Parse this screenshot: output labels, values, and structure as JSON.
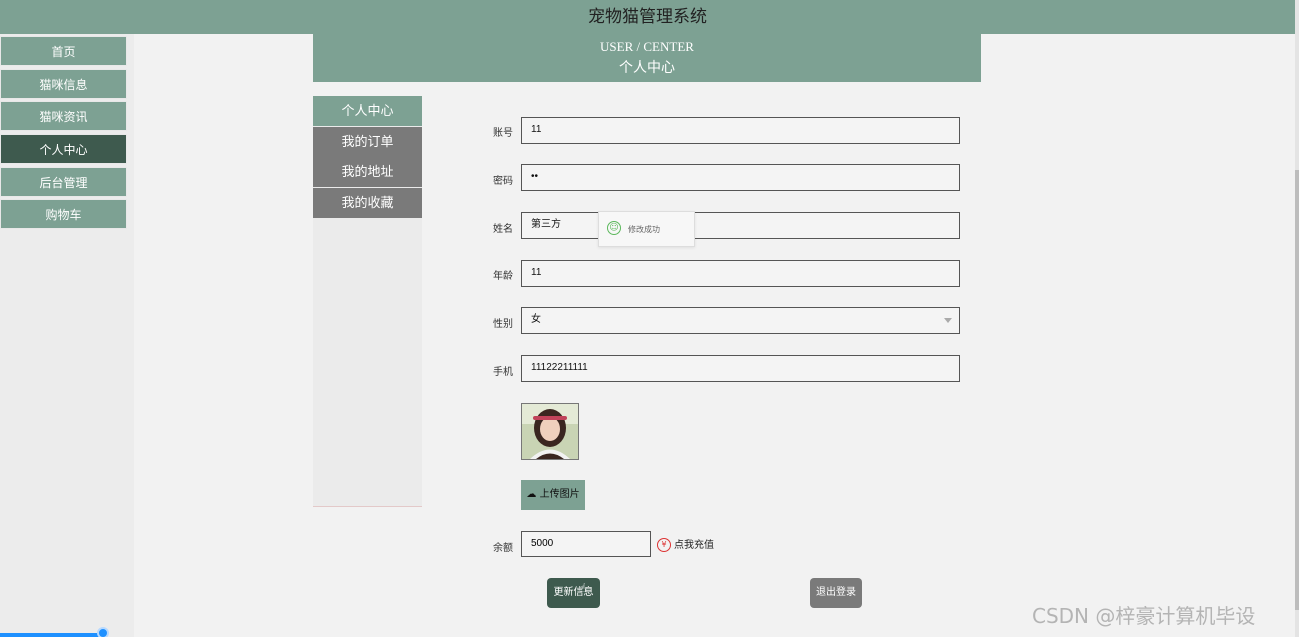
{
  "header": {
    "title": "宠物猫管理系统"
  },
  "nav": {
    "items": [
      {
        "label": "首页",
        "active": false
      },
      {
        "label": "猫咪信息",
        "active": false
      },
      {
        "label": "猫咪资讯",
        "active": false
      },
      {
        "label": "个人中心",
        "active": true
      },
      {
        "label": "后台管理",
        "active": false
      },
      {
        "label": "购物车",
        "active": false
      }
    ]
  },
  "banner": {
    "en": "USER / CENTER",
    "zh": "个人中心"
  },
  "sub_menu": {
    "items": [
      {
        "label": "个人中心",
        "active": true
      },
      {
        "label": "我的订单",
        "active": false
      },
      {
        "label": "我的地址",
        "active": false
      },
      {
        "label": "我的收藏",
        "active": false
      }
    ]
  },
  "form": {
    "account_label": "账号",
    "account_value": "11",
    "password_label": "密码",
    "password_value": "••",
    "name_label": "姓名",
    "name_value": "第三方",
    "age_label": "年龄",
    "age_value": "11",
    "gender_label": "性别",
    "gender_value": "女",
    "phone_label": "手机",
    "phone_value": "11122211111",
    "upload_label": "上传图片",
    "balance_label": "余额",
    "balance_value": "5000",
    "recharge_label": "点我充值"
  },
  "actions": {
    "update_label": "更新信息",
    "logout_label": "退出登录"
  },
  "toast": {
    "text": "修改成功"
  },
  "watermark": {
    "text": "CSDN @梓豪计算机毕设"
  },
  "colors": {
    "accent": "#7da193",
    "dark_accent": "#3e5a4e",
    "gray_button": "#7a7a7a"
  }
}
